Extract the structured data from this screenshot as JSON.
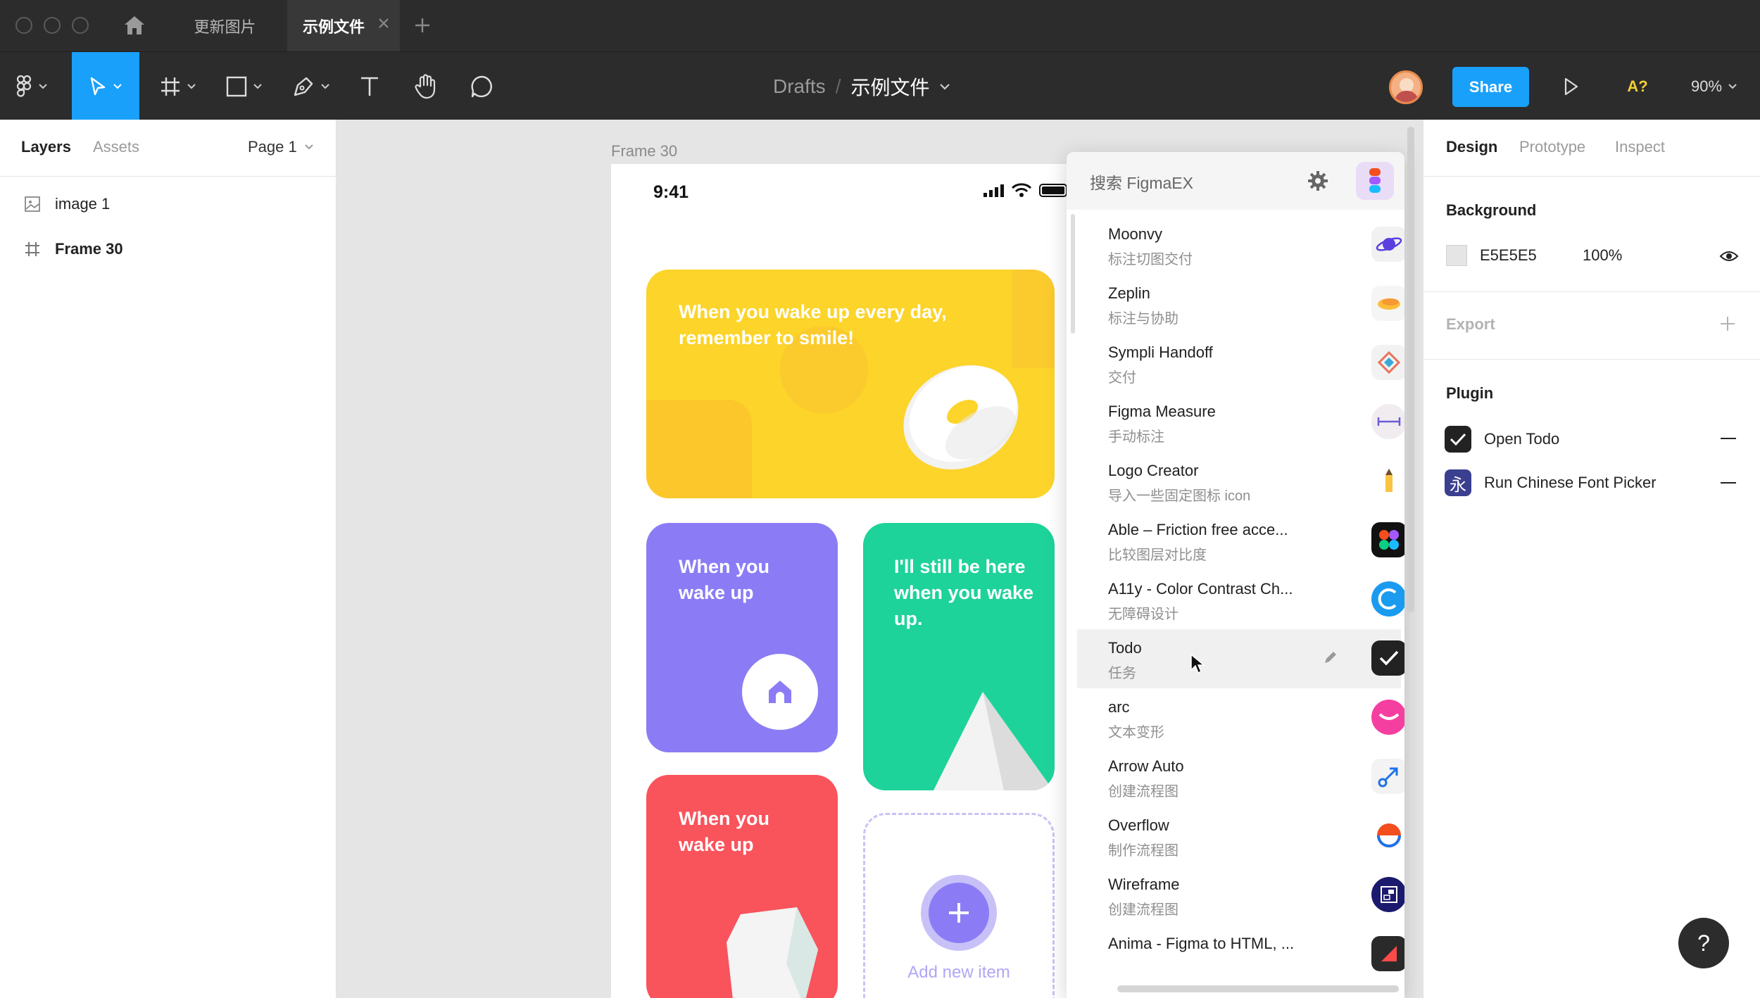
{
  "tabs": [
    {
      "label": "更新图片"
    },
    {
      "label": "示例文件"
    }
  ],
  "toolbar": {
    "breadcrumb_parent": "Drafts",
    "breadcrumb_separator": "/",
    "file_name": "示例文件",
    "share_label": "Share",
    "font_check_label": "A?",
    "zoom": "90%"
  },
  "layers_panel": {
    "tab_layers": "Layers",
    "tab_assets": "Assets",
    "page": "Page 1",
    "layers": [
      {
        "name": "image 1",
        "icon": "image-icon"
      },
      {
        "name": "Frame 30",
        "icon": "frame-icon"
      }
    ]
  },
  "canvas": {
    "frame_label": "Frame 30",
    "status_time": "9:41",
    "cards": {
      "yellow": "When you wake up every day, remember to smile!",
      "purple": "When you wake up",
      "green": "I'll still be here when you wake up.",
      "red": "When you wake up",
      "add": "Add new item"
    }
  },
  "plugin_popup": {
    "search_placeholder": "搜索 FigmaEX",
    "items": [
      {
        "name": "Moonvy",
        "desc": "标注切图交付",
        "icon": "planet-icon"
      },
      {
        "name": "Zeplin",
        "desc": "标注与协助",
        "icon": "zeplin-icon"
      },
      {
        "name": "Sympli Handoff",
        "desc": "交付",
        "icon": "sympli-icon"
      },
      {
        "name": "Figma Measure",
        "desc": "手动标注",
        "icon": "measure-icon"
      },
      {
        "name": "Logo Creator",
        "desc": "导入一些固定图标 icon",
        "icon": "pencil-icon"
      },
      {
        "name": "Able – Friction free acce...",
        "desc": "比较图层对比度",
        "icon": "able-icon"
      },
      {
        "name": "A11y - Color Contrast Ch...",
        "desc": "无障碍设计",
        "icon": "contrast-icon"
      },
      {
        "name": "Todo",
        "desc": "任务",
        "icon": "todo-check-icon"
      },
      {
        "name": "arc",
        "desc": "文本变形",
        "icon": "arc-icon"
      },
      {
        "name": "Arrow Auto",
        "desc": "创建流程图",
        "icon": "arrow-auto-icon"
      },
      {
        "name": "Overflow",
        "desc": "制作流程图",
        "icon": "overflow-icon"
      },
      {
        "name": "Wireframe",
        "desc": "创建流程图",
        "icon": "wireframe-icon"
      },
      {
        "name": "Anima - Figma to HTML, ...",
        "desc": "",
        "icon": "anima-icon"
      }
    ]
  },
  "design_panel": {
    "tab_design": "Design",
    "tab_prototype": "Prototype",
    "tab_inspect": "Inspect",
    "background_title": "Background",
    "background_hex": "E5E5E5",
    "background_opacity": "100%",
    "export_title": "Export",
    "plugin_title": "Plugin",
    "plugins": [
      {
        "label": "Open Todo",
        "icon": "todo-check-icon"
      },
      {
        "label": "Run Chinese Font Picker",
        "icon": "yong-char-icon",
        "glyph": "永"
      }
    ]
  },
  "colors": {
    "accent": "#18a0fb",
    "yellow_card": "#fcd42a",
    "purple_card": "#8b7cf6",
    "green_card": "#1dd39a",
    "red_card": "#f9535c",
    "canvas_bg": "#e5e5e5"
  },
  "help_label": "?"
}
